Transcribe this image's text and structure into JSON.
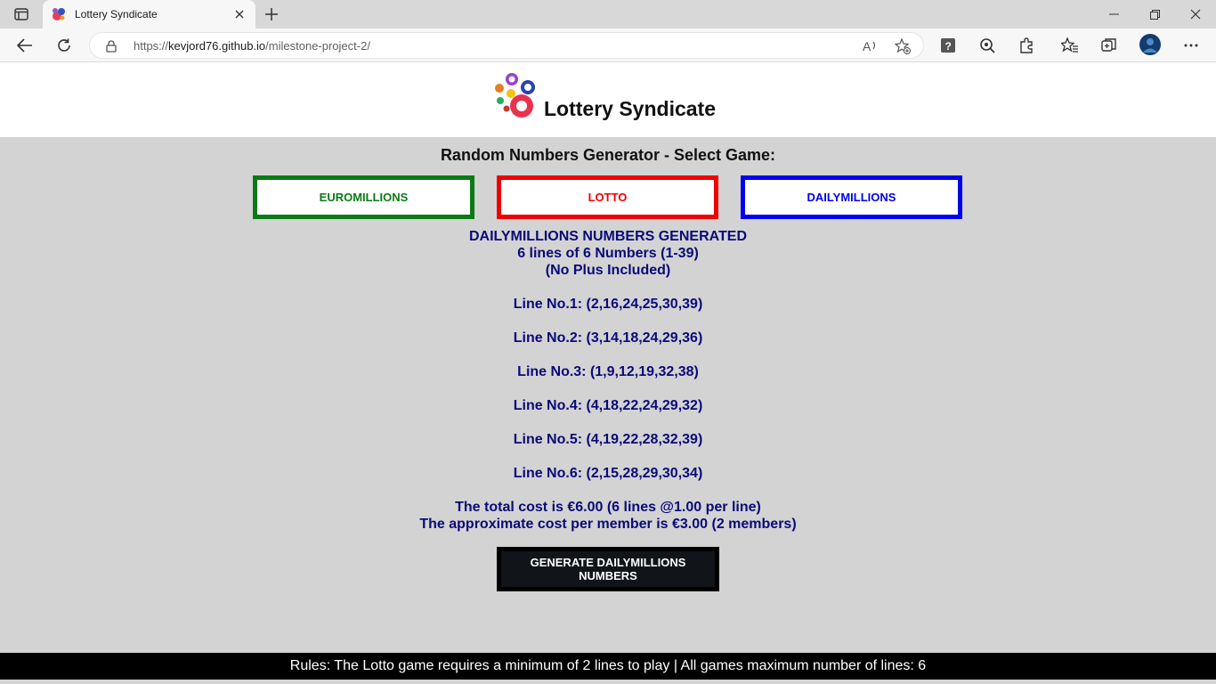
{
  "browser": {
    "tab_title": "Lottery Syndicate",
    "url_prefix": "https://",
    "url_host": "kevjord76.github.io",
    "url_path": "/milestone-project-2/"
  },
  "header": {
    "title": "Lottery Syndicate"
  },
  "main": {
    "section_title": "Random Numbers Generator - Select Game:",
    "games": [
      {
        "label": "EUROMILLIONS",
        "color": "#0a7a14"
      },
      {
        "label": "LOTTO",
        "color": "#ee0000"
      },
      {
        "label": "DAILYMILLIONS",
        "color": "#0000ee"
      }
    ],
    "results": {
      "heading": "DAILYMILLIONS NUMBERS GENERATED",
      "subheading": "6 lines of 6 Numbers (1-39)",
      "note": "(No Plus Included)",
      "lines": [
        "Line No.1: (2,16,24,25,30,39)",
        "Line No.2: (3,14,18,24,29,36)",
        "Line No.3: (1,9,12,19,32,38)",
        "Line No.4: (4,18,22,24,29,32)",
        "Line No.5: (4,19,22,28,32,39)",
        "Line No.6: (2,15,28,29,30,34)"
      ],
      "total_cost": "The total cost is €6.00 (6 lines @1.00 per line)",
      "member_cost": "The approximate cost per member is €3.00 (2 members)"
    },
    "generate_button": "GENERATE DAILYMILLIONS NUMBERS"
  },
  "footer": {
    "rules": "Rules: The Lotto game requires a minimum of 2 lines to play | All games maximum number of lines: 6"
  },
  "colors": {
    "results_text": "#0a0a7a",
    "page_bg": "#d3d3d3"
  }
}
